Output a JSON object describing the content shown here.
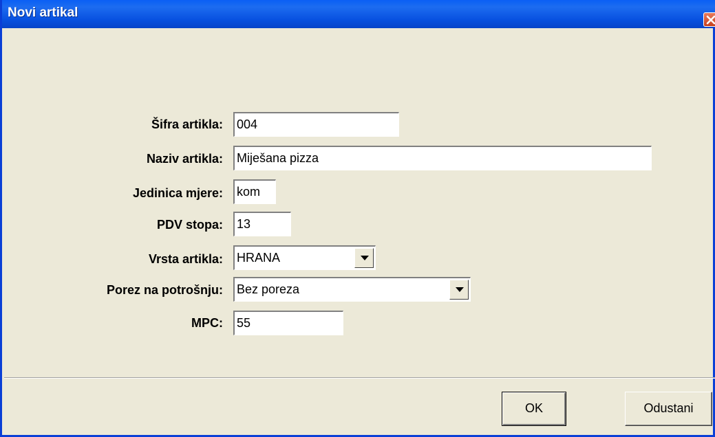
{
  "window": {
    "title": "Novi artikal"
  },
  "form": {
    "sifra": {
      "label": "Šifra artikla:",
      "value": "004"
    },
    "naziv": {
      "label": "Naziv artikla:",
      "value": "Miješana pizza"
    },
    "jedinica": {
      "label": "Jedinica mjere:",
      "value": "kom"
    },
    "pdv": {
      "label": "PDV stopa:",
      "value": "13"
    },
    "vrsta": {
      "label": "Vrsta artikla:",
      "value": "HRANA"
    },
    "porez": {
      "label": "Porez na potrošnju:",
      "value": "Bez poreza"
    },
    "mpc": {
      "label": "MPC:",
      "value": "55"
    }
  },
  "buttons": {
    "ok": "OK",
    "cancel": "Odustani"
  }
}
